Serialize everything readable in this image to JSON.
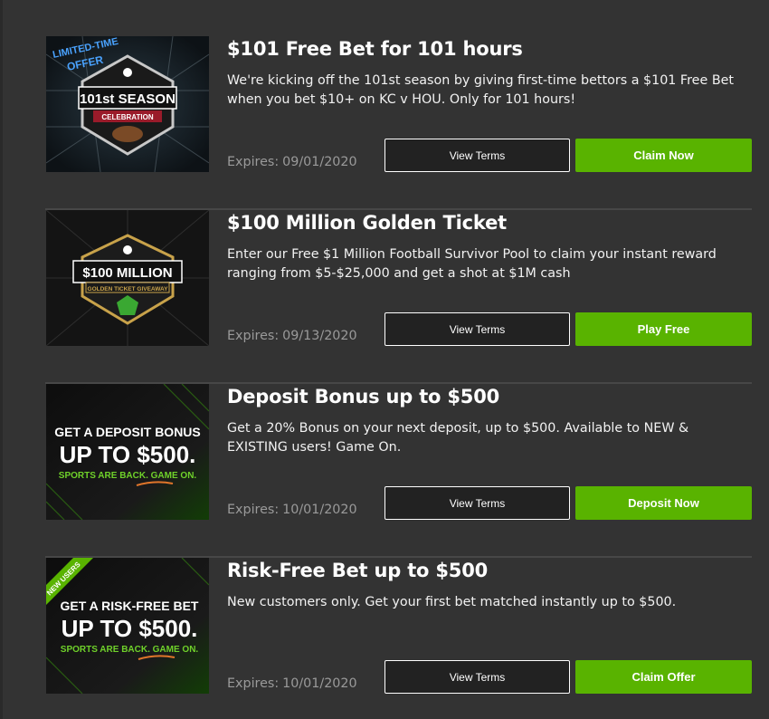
{
  "colors": {
    "background": "#333333",
    "accent_green": "#59b300",
    "divider": "#474747",
    "expires_text": "#9a9a9a"
  },
  "promotions": [
    {
      "title": "$101 Free Bet for 101 hours",
      "description": "We're kicking off the 101st season by giving first-time bettors a $101 Free Bet when you bet $10+ on KC v HOU. Only for 101 hours!",
      "expires_label": "Expires:",
      "expires_date": "09/01/2020",
      "terms_label": "View Terms",
      "cta_label": "Claim Now",
      "image": {
        "ribbon_line1": "LIMITED-TIME",
        "ribbon_line2": "OFFER",
        "badge_line1": "101st SEASON",
        "badge_line2": "CELEBRATION"
      }
    },
    {
      "title": "$100 Million Golden Ticket",
      "description": "Enter our Free $1 Million Football Survivor Pool to claim your instant reward ranging from $5-$25,000 and get a shot at $1M cash",
      "expires_label": "Expires:",
      "expires_date": "09/13/2020",
      "terms_label": "View Terms",
      "cta_label": "Play Free",
      "image": {
        "badge_line1": "$100 MILLION",
        "badge_line2": "GOLDEN TICKET GIVEAWAY"
      }
    },
    {
      "title": "Deposit Bonus up to $500",
      "description": "Get a 20% Bonus on your next deposit, up to $500. Available to NEW & EXISTING users! Game On.",
      "expires_label": "Expires:",
      "expires_date": "10/01/2020",
      "terms_label": "View Terms",
      "cta_label": "Deposit Now",
      "image": {
        "line1": "GET A DEPOSIT BONUS",
        "line2": "UP TO $500.",
        "line3": "SPORTS ARE BACK. GAME ON."
      }
    },
    {
      "title": "Risk-Free Bet up to $500",
      "description": "New customers only. Get your first bet matched instantly up to $500.",
      "expires_label": "Expires:",
      "expires_date": "10/01/2020",
      "terms_label": "View Terms",
      "cta_label": "Claim Offer",
      "image": {
        "corner_ribbon": "NEW USERS",
        "line1": "GET A RISK-FREE BET",
        "line2": "UP TO $500.",
        "line3": "SPORTS ARE BACK. GAME ON."
      }
    }
  ]
}
